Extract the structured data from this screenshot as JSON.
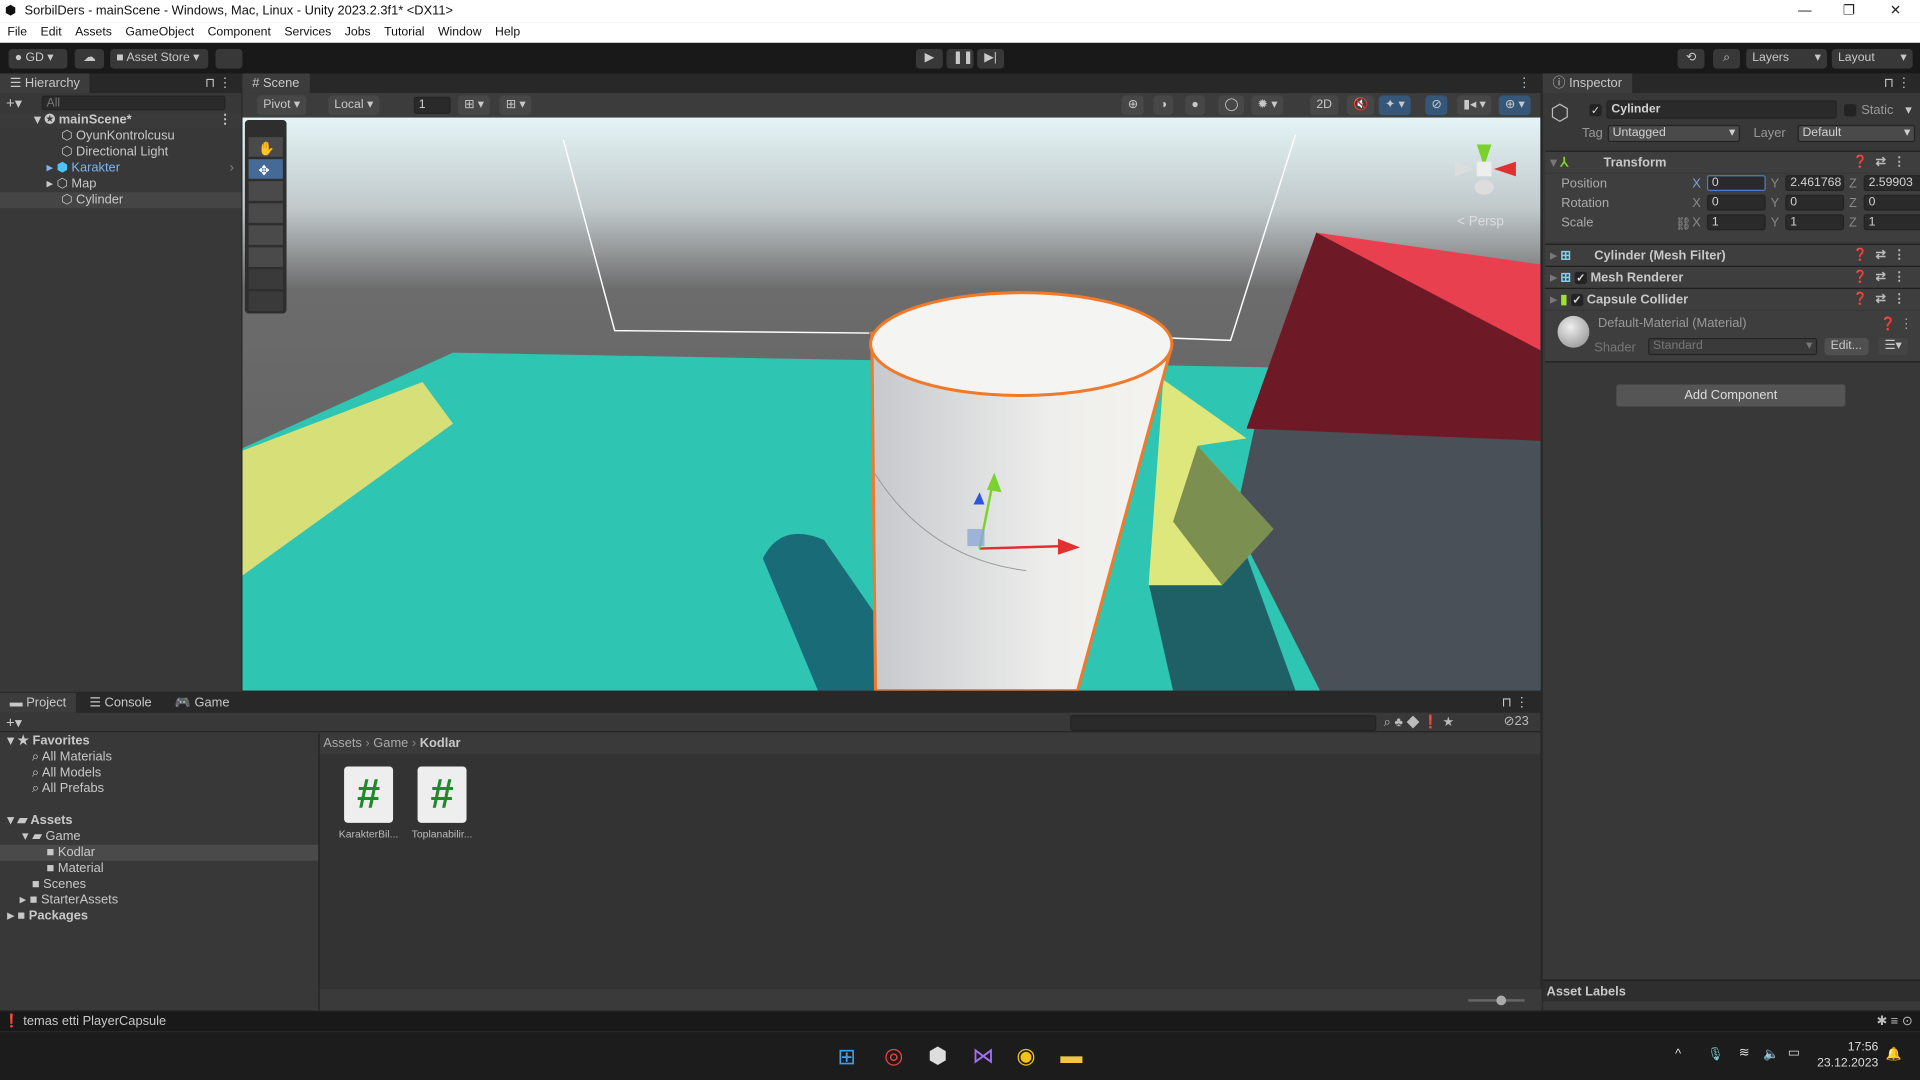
{
  "window": {
    "title": "SorbilDers - mainScene - Windows, Mac, Linux - Unity 2023.2.3f1* <DX11>",
    "controls": [
      "—",
      "❐",
      "✕"
    ]
  },
  "menu": [
    "File",
    "Edit",
    "Assets",
    "GameObject",
    "Component",
    "Services",
    "Jobs",
    "Tutorial",
    "Window",
    "Help"
  ],
  "toolbar": {
    "account": "GD",
    "asset_store": "Asset Store",
    "layers": "Layers",
    "layout": "Layout"
  },
  "hierarchy": {
    "title": "Hierarchy",
    "search_placeholder": "All",
    "scene": "mainScene*",
    "items": [
      {
        "label": "OyunKontrolcusu"
      },
      {
        "label": "Directional Light"
      },
      {
        "label": "Karakter"
      },
      {
        "label": "Map"
      },
      {
        "label": "Cylinder"
      }
    ]
  },
  "scene": {
    "tab": "Scene",
    "pivot": "Pivot",
    "local": "Local",
    "grid_value": "1",
    "mode_2d": "2D",
    "persp": "< Persp",
    "colors": {
      "teal": "#2ec5b2",
      "red": "#e8404f",
      "darkred": "#6e1a26",
      "yellow": "#d7df78",
      "selection": "#f07a2a"
    }
  },
  "inspector": {
    "title": "Inspector",
    "object_name": "Cylinder",
    "static": "Static",
    "tag_label": "Tag",
    "tag": "Untagged",
    "layer_label": "Layer",
    "layer": "Default",
    "transform": {
      "title": "Transform",
      "rows": [
        {
          "label": "Position",
          "x": "0",
          "y": "2.461768",
          "z": "2.59903"
        },
        {
          "label": "Rotation",
          "x": "0",
          "y": "0",
          "z": "0"
        },
        {
          "label": "Scale",
          "x": "1",
          "y": "1",
          "z": "1"
        }
      ]
    },
    "components": [
      "Cylinder (Mesh Filter)",
      "Mesh Renderer",
      "Capsule Collider"
    ],
    "material": {
      "name": "Default-Material (Material)",
      "shader_label": "Shader",
      "shader": "Standard",
      "edit": "Edit..."
    },
    "add_component": "Add Component",
    "asset_labels": "Asset Labels"
  },
  "bottom": {
    "tabs": [
      "Project",
      "Console",
      "Game"
    ],
    "hidden_count": "23",
    "favorites": {
      "label": "Favorites",
      "items": [
        "All Materials",
        "All Models",
        "All Prefabs"
      ]
    },
    "assets": {
      "label": "Assets",
      "game": "Game",
      "game_children": [
        "Kodlar",
        "Material"
      ],
      "others": [
        "Scenes",
        "StarterAssets"
      ]
    },
    "packages": "Packages",
    "breadcrumb": [
      "Assets",
      "Game",
      "Kodlar"
    ],
    "files": [
      {
        "name": "KarakterBil..."
      },
      {
        "name": "Toplanabilir..."
      }
    ]
  },
  "status": {
    "message": "temas etti PlayerCapsule"
  },
  "taskbar": {
    "time": "17:56",
    "date": "23.12.2023"
  }
}
